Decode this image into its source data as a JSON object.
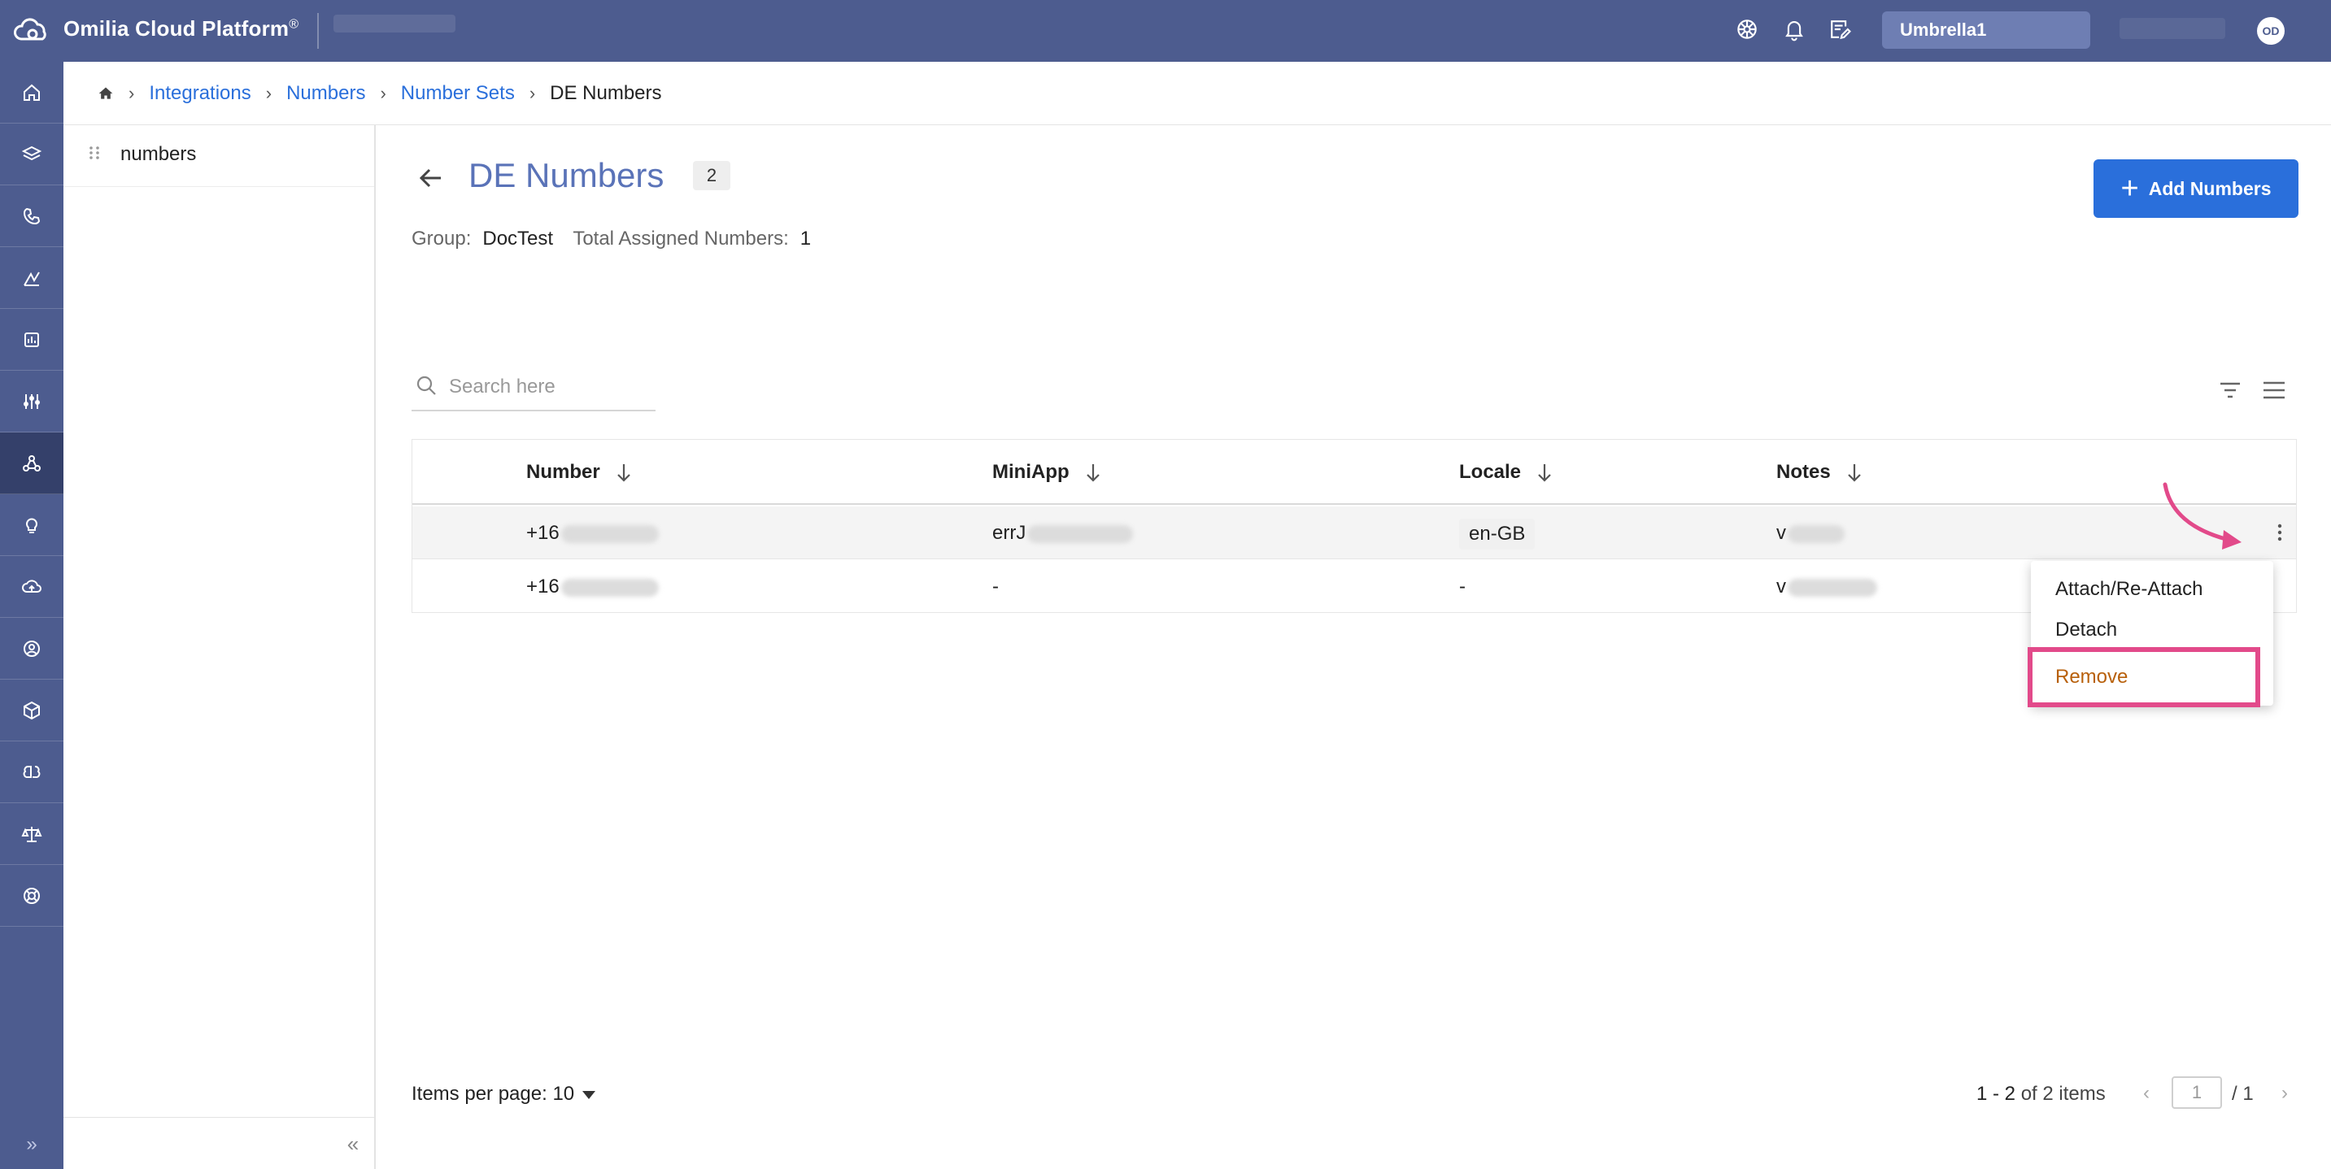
{
  "topbar": {
    "brand": "Omilia Cloud Platform",
    "brand_reg": "®",
    "workspace": "Umbrella1",
    "avatar_initials": "OD",
    "icons": [
      "help-wheel-icon",
      "bell-icon",
      "notes-edit-icon"
    ]
  },
  "sidebar": {
    "items": [
      {
        "name": "home-icon"
      },
      {
        "name": "layers-icon"
      },
      {
        "name": "phone-icon"
      },
      {
        "name": "analytics-icon"
      },
      {
        "name": "reports-icon"
      },
      {
        "name": "settings-sliders-icon"
      },
      {
        "name": "integrations-icon",
        "active": true
      },
      {
        "name": "bulb-icon"
      },
      {
        "name": "cloud-upload-icon"
      },
      {
        "name": "support-icon"
      },
      {
        "name": "cube-icon"
      },
      {
        "name": "brain-icon"
      },
      {
        "name": "balance-icon"
      },
      {
        "name": "lifebuoy-icon"
      }
    ],
    "expand_label": "»"
  },
  "breadcrumb": {
    "home_icon": "home-icon",
    "items": [
      "Integrations",
      "Numbers",
      "Number Sets"
    ],
    "current": "DE Numbers",
    "separator": "›"
  },
  "left_panel": {
    "tree_item": "numbers",
    "collapse_label": "«"
  },
  "header": {
    "title": "DE Numbers",
    "count": "2",
    "add_button": "Add Numbers",
    "group_label": "Group:",
    "group_value": "DocTest",
    "assigned_label": "Total Assigned Numbers:",
    "assigned_value": "1"
  },
  "search": {
    "placeholder": "Search here"
  },
  "table": {
    "columns": [
      "Number",
      "MiniApp",
      "Locale",
      "Notes"
    ],
    "rows": [
      {
        "number": "+16",
        "miniapp": "errJ",
        "locale": "en-GB",
        "notes": "v"
      },
      {
        "number": "+16",
        "miniapp": "-",
        "locale": "-",
        "notes": "v"
      }
    ]
  },
  "context_menu": {
    "items": [
      "Attach/Re-Attach",
      "Detach",
      "Remove"
    ],
    "highlight_color": "#e24a8a",
    "remove_color": "#b8600b"
  },
  "pagination": {
    "items_per_page_label": "Items per page:",
    "items_per_page_value": "10",
    "range": "1 - 2",
    "range_suffix": "of 2 items",
    "page": "1",
    "total_pages": "/ 1"
  },
  "colors": {
    "topbar": "#4d5c8f",
    "primary": "#2a6fdb",
    "title": "#5a73b8"
  }
}
